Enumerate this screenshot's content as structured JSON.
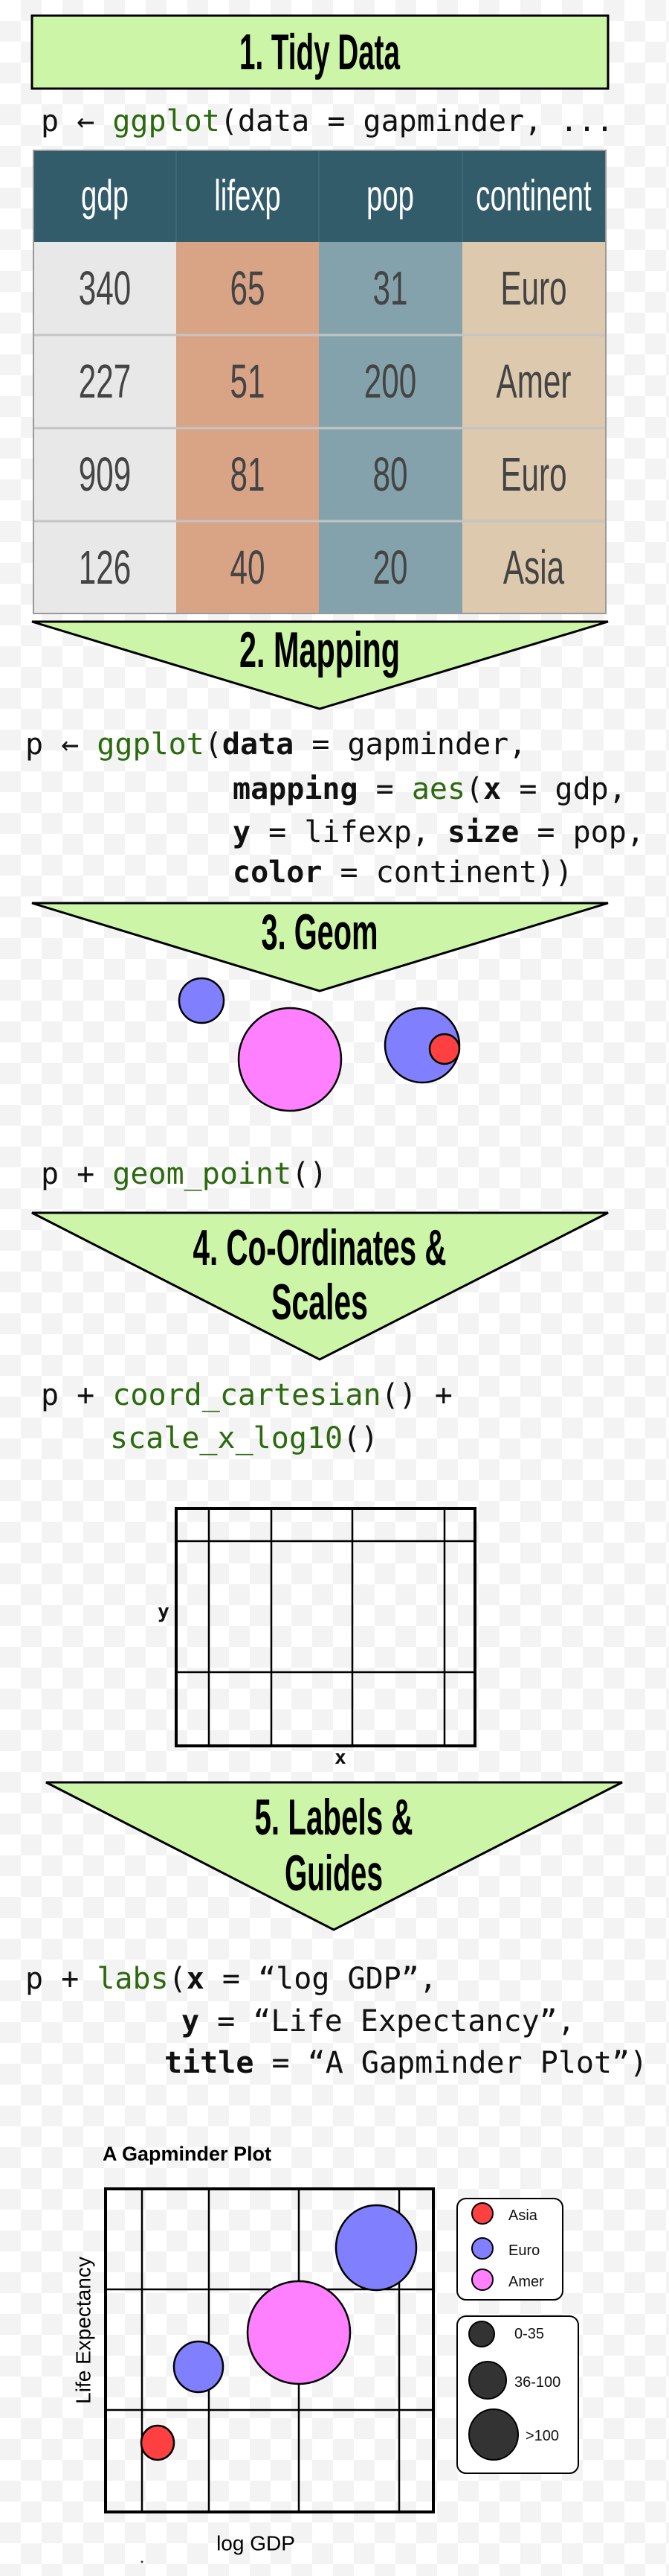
{
  "colors": {
    "step_fill": "#ccf5a8",
    "code_function": "#2b6a0e",
    "table_header": "#335c6b",
    "col_gdp": "#e8e8e8",
    "col_lifexp": "#d9a386",
    "col_pop": "#84a2ab",
    "col_continent": "#ddc9ad",
    "asia": "#ff4040",
    "euro": "#8080ff",
    "amer": "#ff80ff",
    "size_key": "#333333"
  },
  "steps": [
    {
      "lines": [
        "1. Tidy Data"
      ]
    },
    {
      "lines": [
        "2. Mapping"
      ]
    },
    {
      "lines": [
        "3. Geom"
      ]
    },
    {
      "lines": [
        "4. Co-Ordinates &",
        "Scales"
      ]
    },
    {
      "lines": [
        "5. Labels &",
        "Guides"
      ]
    }
  ],
  "code": {
    "step1": [
      [
        {
          "t": "p ← "
        },
        {
          "t": "ggplot",
          "c": "fn"
        },
        {
          "t": "(data = gapminder, ..."
        }
      ]
    ],
    "step2": [
      [
        {
          "t": "p ← "
        },
        {
          "t": "ggplot",
          "c": "fn"
        },
        {
          "t": "("
        },
        {
          "t": "data",
          "c": "kw"
        },
        {
          "t": " = gapminder,"
        }
      ],
      [
        {
          "t": "mapping",
          "c": "kw"
        },
        {
          "t": " = "
        },
        {
          "t": "aes",
          "c": "fn"
        },
        {
          "t": "("
        },
        {
          "t": "x",
          "c": "kw"
        },
        {
          "t": " = gdp,"
        }
      ],
      [
        {
          "t": "y",
          "c": "kw"
        },
        {
          "t": " = lifexp, "
        },
        {
          "t": "size",
          "c": "kw"
        },
        {
          "t": " = pop,"
        }
      ],
      [
        {
          "t": "color",
          "c": "kw"
        },
        {
          "t": " = continent))"
        }
      ]
    ],
    "step3": [
      [
        {
          "t": "p + "
        },
        {
          "t": "geom_point",
          "c": "fn"
        },
        {
          "t": "()"
        }
      ]
    ],
    "step4": [
      [
        {
          "t": "p + "
        },
        {
          "t": "coord_cartesian",
          "c": "fn"
        },
        {
          "t": "() +"
        }
      ],
      [
        {
          "t": "scale_x_log10",
          "c": "fn"
        },
        {
          "t": "()"
        }
      ]
    ],
    "step5": [
      [
        {
          "t": "p + "
        },
        {
          "t": "labs",
          "c": "fn"
        },
        {
          "t": "("
        },
        {
          "t": "x",
          "c": "kw"
        },
        {
          "t": " = “log GDP”,"
        }
      ],
      [
        {
          "t": "y",
          "c": "kw"
        },
        {
          "t": " = “Life Expectancy”,"
        }
      ],
      [
        {
          "t": "title",
          "c": "kw"
        },
        {
          "t": " = “A Gapminder Plot”)"
        }
      ]
    ]
  },
  "table": {
    "columns": [
      "gdp",
      "lifexp",
      "pop",
      "continent"
    ],
    "rows": [
      [
        "340",
        "65",
        "31",
        "Euro"
      ],
      [
        "227",
        "51",
        "200",
        "Amer"
      ],
      [
        "909",
        "81",
        "80",
        "Euro"
      ],
      [
        "126",
        "40",
        "20",
        "Asia"
      ]
    ]
  },
  "coord_plot": {
    "x_label": "x",
    "y_label": "y"
  },
  "final_plot": {
    "title": "A Gapminder Plot",
    "x_label": "log GDP",
    "y_label": "Life Expectancy",
    "color_legend": [
      {
        "label": "Asia",
        "color": "#ff4040"
      },
      {
        "label": "Euro",
        "color": "#8080ff"
      },
      {
        "label": "Amer",
        "color": "#ff80ff"
      }
    ],
    "size_legend": [
      "0-35",
      "36-100",
      ">100"
    ]
  }
}
